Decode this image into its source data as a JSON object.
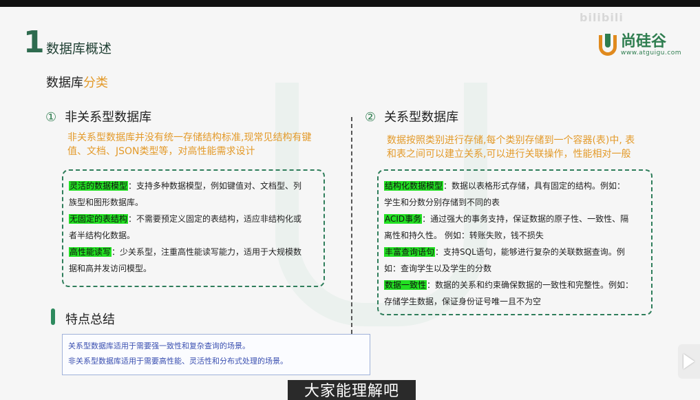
{
  "header": {
    "number": "1",
    "title": "数据库概述"
  },
  "logo": {
    "name": "尚硅谷",
    "url": "www.atguigu.com"
  },
  "watermark": "bilibili",
  "subtitle": {
    "main": "数据库",
    "accent": "分类"
  },
  "left": {
    "circle": "①",
    "heading": "非关系型数据库",
    "desc": [
      "非关系型数据库并没有统一存储结构标准,现常见结构有键",
      "值、文档、JSON类型等，对高性能需求设计"
    ],
    "items": [
      {
        "tag": "灵活的数据模型",
        "lines": [
          "：支持多种数据模型，例如键值对、文档型、列",
          "族型和图形数据库。"
        ]
      },
      {
        "tag": "无固定的表结构",
        "lines": [
          "：不需要预定义固定的表结构，适应非结构化或",
          "者半结构化数据。"
        ]
      },
      {
        "tag": "高性能读写",
        "lines": [
          "：少关系型，注重高性能读写能力，适用于大规模数",
          "据和高并发访问模型。"
        ]
      }
    ]
  },
  "right": {
    "circle": "②",
    "heading": "关系型数据库",
    "desc": [
      "数据按照类别进行存储,每个类别存储到一个容器(表)中, 表",
      "和表之间可以建立关系,可以进行关联操作，性能相对一般"
    ],
    "items": [
      {
        "tag": "结构化数据模型",
        "lines": [
          "：数据以表格形式存储，具有固定的结构。例如：",
          "学生和分数分别存储到不同的表"
        ]
      },
      {
        "tag": "ACID事务",
        "lines": [
          "：通过强大的事务支持，保证数据的原子性、一致性、隔",
          "离性和持久性。 例如：转账失败，钱不损失"
        ]
      },
      {
        "tag": "丰富查询语句",
        "lines": [
          "：支持SQL语句，能够进行复杂的关联数据查询。例",
          "如：查询学生以及学生的分数"
        ]
      },
      {
        "tag": "数据一致性",
        "lines": [
          "：数据的关系和约束确保数据的一致性和完整性。例如：",
          "存储学生数据，保证身份证号唯一且不为空"
        ]
      }
    ]
  },
  "summary": {
    "title": "特点总结",
    "lines": [
      "关系型数据库适用于需要强一致性和复杂查询的场景。",
      "非关系型数据库适用于需要高性能、灵活性和分布式处理的场景。"
    ]
  },
  "subtitle_caption": "大家能理解吧"
}
